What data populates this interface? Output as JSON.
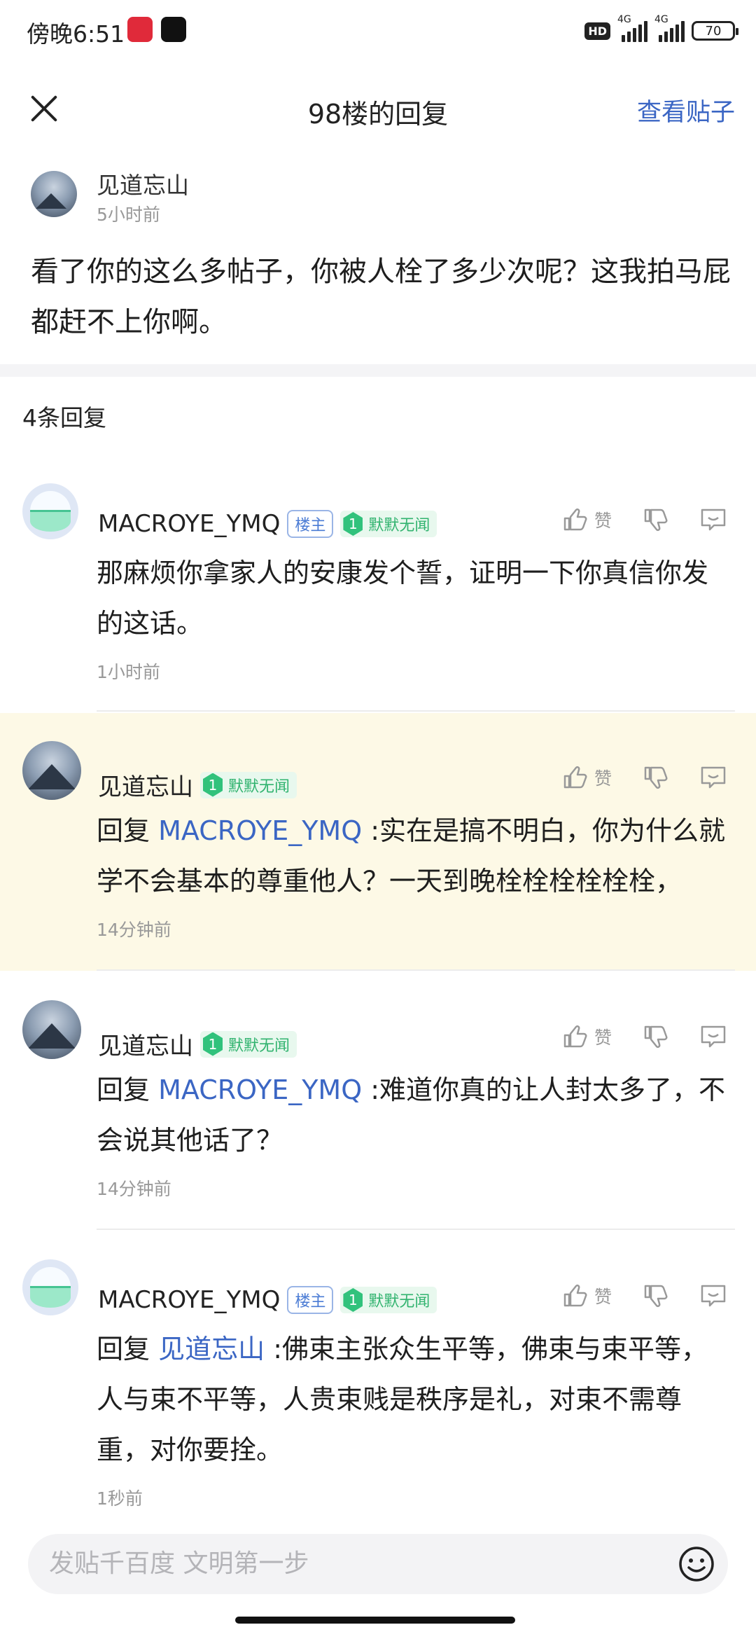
{
  "status": {
    "time": "傍晚6:51",
    "hd": "HD",
    "net1": "4G",
    "net2": "4G",
    "battery": "70"
  },
  "header": {
    "title": "98楼的回复",
    "view_post": "查看贴子"
  },
  "op": {
    "name": "见道忘山",
    "time": "5小时前",
    "content": "看了你的这么多帖子，你被人栓了多少次呢？这我拍马屁都赶不上你啊。"
  },
  "reply_count": "4条回复",
  "replies": [
    {
      "name": "MACROYE_YMQ",
      "owner_tag": "楼主",
      "level": "1",
      "level_title": "默默无闻",
      "like": "赞",
      "prefix": "",
      "target": "",
      "text": "那麻烦你拿家人的安康发个誓，证明一下你真信你发的这话。",
      "time": "1小时前"
    },
    {
      "name": "见道忘山",
      "owner_tag": "",
      "level": "1",
      "level_title": "默默无闻",
      "like": "赞",
      "prefix": "回复 ",
      "target": "MACROYE_YMQ",
      "text": " :实在是搞不明白，你为什么就学不会基本的尊重他人？一天到晚栓栓栓栓栓栓，",
      "time": "14分钟前"
    },
    {
      "name": "见道忘山",
      "owner_tag": "",
      "level": "1",
      "level_title": "默默无闻",
      "like": "赞",
      "prefix": "回复 ",
      "target": "MACROYE_YMQ",
      "text": " :难道你真的让人封太多了，不会说其他话了？",
      "time": "14分钟前"
    },
    {
      "name": "MACROYE_YMQ",
      "owner_tag": "楼主",
      "level": "1",
      "level_title": "默默无闻",
      "like": "赞",
      "prefix": "回复 ",
      "target": "见道忘山",
      "text": " :佛束主张众生平等，佛束与束平等，人与束不平等，人贵束贱是秩序是礼，对束不需尊重，对你要拴。",
      "time": "1秒前"
    }
  ],
  "input": {
    "placeholder": "发贴千百度 文明第一步"
  },
  "colors": {
    "accent": "#3b66c4",
    "highlight_bg": "#fdf9e6",
    "level_green": "#31c27c"
  },
  "icons": [
    "close-icon",
    "thumbs-up-icon",
    "thumbs-down-icon",
    "comment-icon",
    "emoji-icon"
  ]
}
